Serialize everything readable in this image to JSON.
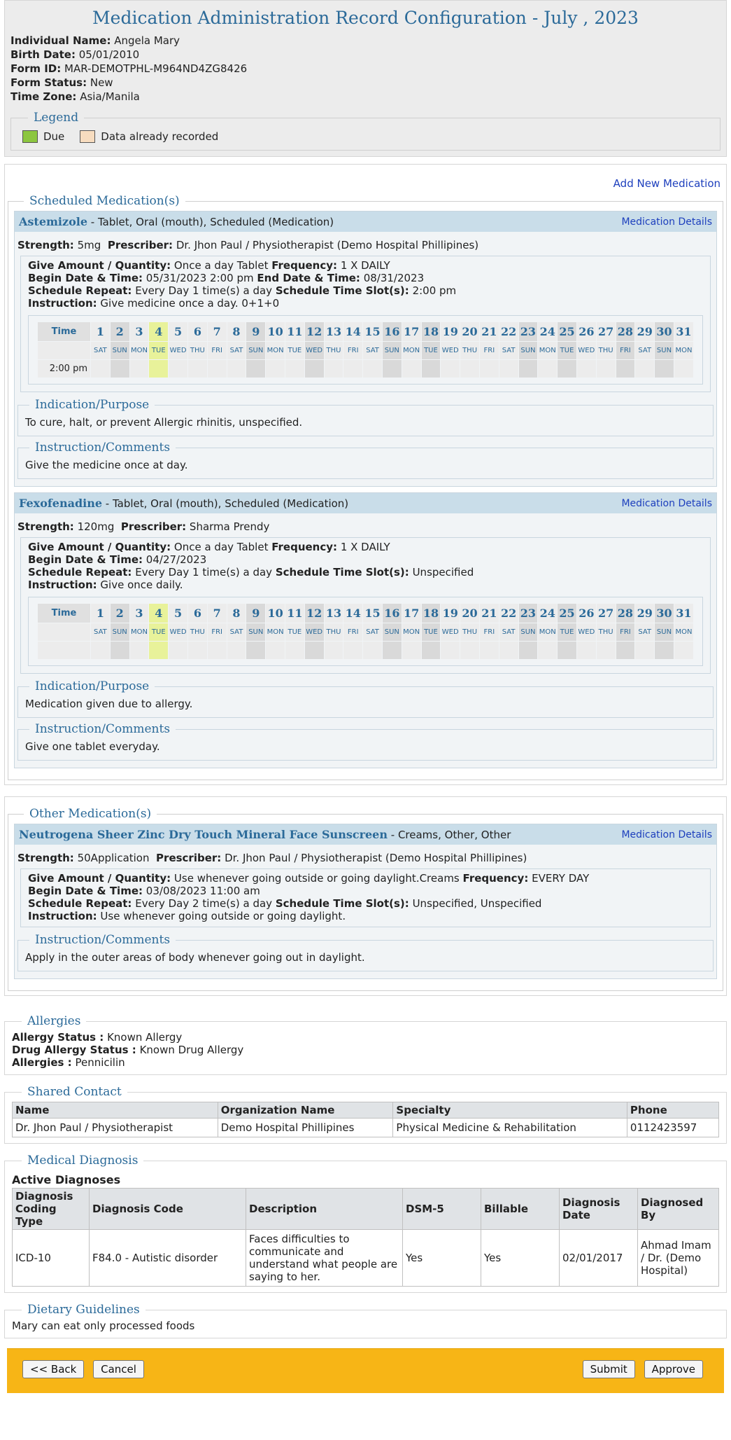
{
  "header": {
    "title": "Medication Administration Record Configuration - July , 2023",
    "fields": [
      {
        "label": "Individual Name:",
        "value": "Angela Mary"
      },
      {
        "label": "Birth Date:",
        "value": "05/01/2010"
      },
      {
        "label": "Form ID:",
        "value": "MAR-DEMOTPHL-M964ND4ZG8426"
      },
      {
        "label": "Form Status:",
        "value": "New"
      },
      {
        "label": "Time Zone:",
        "value": "Asia/Manila"
      }
    ],
    "legend_title": "Legend",
    "legend_due": "Due",
    "legend_recorded": "Data already recorded",
    "colors": {
      "due": "#8cc63f",
      "recorded": "#f7dcbf",
      "title": "#2b6a99"
    }
  },
  "calendar": {
    "time_label": "Time",
    "days": [
      "1",
      "2",
      "3",
      "4",
      "5",
      "6",
      "7",
      "8",
      "9",
      "10",
      "11",
      "12",
      "13",
      "14",
      "15",
      "16",
      "17",
      "18",
      "19",
      "20",
      "21",
      "22",
      "23",
      "24",
      "25",
      "26",
      "27",
      "28",
      "29",
      "30",
      "31"
    ],
    "day_names": [
      "SAT",
      "SUN",
      "MON",
      "TUE",
      "WED",
      "THU",
      "FRI",
      "SAT",
      "SUN",
      "MON",
      "TUE",
      "WED",
      "THU",
      "FRI",
      "SAT",
      "SUN",
      "MON",
      "TUE",
      "WED",
      "THU",
      "FRI",
      "SAT",
      "SUN",
      "MON",
      "TUE",
      "WED",
      "THU",
      "FRI",
      "SAT",
      "SUN",
      "MON"
    ],
    "today_index": 3
  },
  "scheduled": {
    "add_new": "Add New Medication",
    "title": "Scheduled Medication(s)",
    "meds": [
      {
        "name": "Astemizole",
        "form": " - Tablet, Oral (mouth), Scheduled (Medication)",
        "details": "Medication Details",
        "strength_label": "Strength:",
        "strength": "5mg",
        "prescriber_label": "Prescriber:",
        "prescriber": "Dr. Jhon Paul / Physiotherapist (Demo Hospital Phillipines)",
        "give_label": "Give Amount / Quantity:",
        "give": "Once a day Tablet",
        "freq_label": "Frequency:",
        "freq": "1 X DAILY",
        "begin_label": "Begin Date & Time:",
        "begin": "05/31/2023 2:00 pm",
        "end_label": "End Date & Time:",
        "end": "08/31/2023",
        "repeat_label": "Schedule Repeat:",
        "repeat": "Every Day 1 time(s) a day",
        "slot_label": "Schedule Time Slot(s):",
        "slot": "2:00 pm",
        "instr_label": "Instruction:",
        "instr": "Give medicine once a day. 0+1+0",
        "row_time": "2:00 pm",
        "indication_title": "Indication/Purpose",
        "indication": "To cure, halt, or prevent Allergic rhinitis, unspecified.",
        "comments_title": "Instruction/Comments",
        "comments": "Give the medicine once at day."
      },
      {
        "name": "Fexofenadine",
        "form": " - Tablet, Oral (mouth), Scheduled (Medication)",
        "details": "Medication Details",
        "strength_label": "Strength:",
        "strength": "120mg",
        "prescriber_label": "Prescriber:",
        "prescriber": "Sharma Prendy",
        "give_label": "Give Amount / Quantity:",
        "give": "Once a day Tablet",
        "freq_label": "Frequency:",
        "freq": "1 X DAILY",
        "begin_label": "Begin Date & Time:",
        "begin": "04/27/2023",
        "repeat_label": "Schedule Repeat:",
        "repeat": "Every Day 1 time(s) a day",
        "slot_label": "Schedule Time Slot(s):",
        "slot": "Unspecified",
        "instr_label": "Instruction:",
        "instr": "Give once daily.",
        "row_time": "",
        "indication_title": "Indication/Purpose",
        "indication": "Medication given due to allergy.",
        "comments_title": "Instruction/Comments",
        "comments": "Give one tablet everyday."
      }
    ]
  },
  "other": {
    "title": "Other Medication(s)",
    "med": {
      "name": "Neutrogena Sheer Zinc Dry Touch Mineral Face Sunscreen",
      "form": " - Creams, Other, Other",
      "details": "Medication Details",
      "strength_label": "Strength:",
      "strength": "50Application",
      "prescriber_label": "Prescriber:",
      "prescriber": "Dr. Jhon Paul / Physiotherapist (Demo Hospital Phillipines)",
      "give_label": "Give Amount / Quantity:",
      "give": "Use whenever going outside or going daylight.Creams",
      "freq_label": "Frequency:",
      "freq": "EVERY DAY",
      "begin_label": "Begin Date & Time:",
      "begin": "03/08/2023 11:00 am",
      "repeat_label": "Schedule Repeat:",
      "repeat": "Every Day 2 time(s) a day",
      "slot_label": "Schedule Time Slot(s):",
      "slot": "Unspecified, Unspecified",
      "instr_label": "Instruction:",
      "instr": "Use whenever going outside or going daylight.",
      "comments_title": "Instruction/Comments",
      "comments": "Apply in the outer areas of body whenever going out in daylight."
    }
  },
  "allergies": {
    "title": "Allergies",
    "status_label": "Allergy Status :",
    "status": "Known Allergy",
    "drug_label": "Drug Allergy Status :",
    "drug": "Known Drug Allergy",
    "list_label": "Allergies :",
    "list": "Pennicilin"
  },
  "contact": {
    "title": "Shared Contact",
    "headers": [
      "Name",
      "Organization Name",
      "Specialty",
      "Phone"
    ],
    "rows": [
      [
        "Dr. Jhon Paul / Physiotherapist",
        "Demo Hospital Phillipines",
        "Physical Medicine & Rehabilitation",
        "0112423597"
      ]
    ]
  },
  "diagnosis": {
    "title": "Medical Diagnosis",
    "active_title": "Active Diagnoses",
    "headers": [
      "Diagnosis Coding Type",
      "Diagnosis Code",
      "Description",
      "DSM-5",
      "Billable",
      "Diagnosis Date",
      "Diagnosed By"
    ],
    "rows": [
      [
        "ICD-10",
        "F84.0 - Autistic disorder",
        "Faces difficulties to communicate and understand what people are saying to her.",
        "Yes",
        "Yes",
        "02/01/2017",
        "Ahmad Imam / Dr. (Demo Hospital)"
      ]
    ]
  },
  "diet": {
    "title": "Dietary Guidelines",
    "text": "Mary can eat only processed foods"
  },
  "footer": {
    "back": "<< Back",
    "cancel": "Cancel",
    "submit": "Submit",
    "approve": "Approve"
  }
}
